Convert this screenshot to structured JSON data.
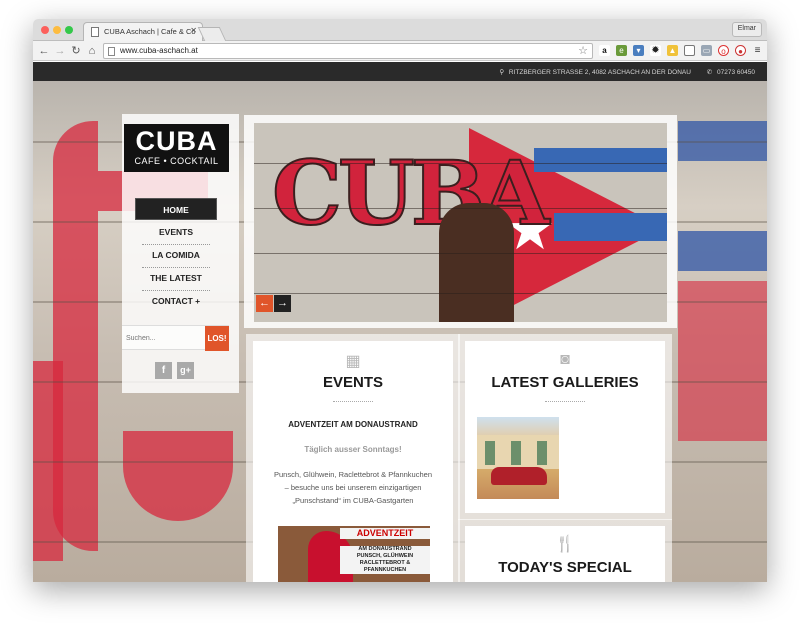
{
  "browser": {
    "tab_title": "CUBA Aschach | Cafe & Co",
    "url": "www.cuba-aschach.at",
    "profile_name": "Elmar"
  },
  "topbar": {
    "address": "RITZBERGER STRASSE 2, 4082 ASCHACH AN DER DONAU",
    "phone": "07273 60450"
  },
  "logo": {
    "line1": "CUBA",
    "line2": "CAFE • COCKTAIL"
  },
  "nav": {
    "items": [
      {
        "label": "HOME"
      },
      {
        "label": "EVENTS"
      },
      {
        "label": "LA COMIDA"
      },
      {
        "label": "THE LATEST"
      },
      {
        "label": "CONTACT +"
      }
    ]
  },
  "search": {
    "placeholder": "Suchen...",
    "button_label": "LOS!"
  },
  "social": {
    "facebook_label": "f",
    "googleplus_label": "g+"
  },
  "slider": {
    "prev_label": "←",
    "next_label": "→"
  },
  "events": {
    "title": "EVENTS",
    "headline": "ADVENTZEIT AM DONAUSTRAND",
    "subline": "Täglich ausser Sonntags!",
    "body": "Punsch, Glühwein, Raclettebrot & Pfannkuchen – besuche uns bei unserem einzigartigen „Punschstand“ im CUBA-Gastgarten",
    "image_title": "ADVENTZEIT",
    "image_subtitle": "AM DONAUSTRAND",
    "image_text": "PUNSCH, GLÜHWEIN RACLETTEBROT & PFANNKUCHEN"
  },
  "galleries": {
    "title": "LATEST GALLERIES"
  },
  "special": {
    "title": "TODAY'S SPECIAL"
  },
  "icons": {
    "calendar": "calendar-icon",
    "camera": "camera-icon",
    "cutlery": "cutlery-icon"
  },
  "colors": {
    "accent_orange": "#e0552a",
    "cuba_red": "#d7283d",
    "cuba_blue": "#3a5ca8"
  }
}
